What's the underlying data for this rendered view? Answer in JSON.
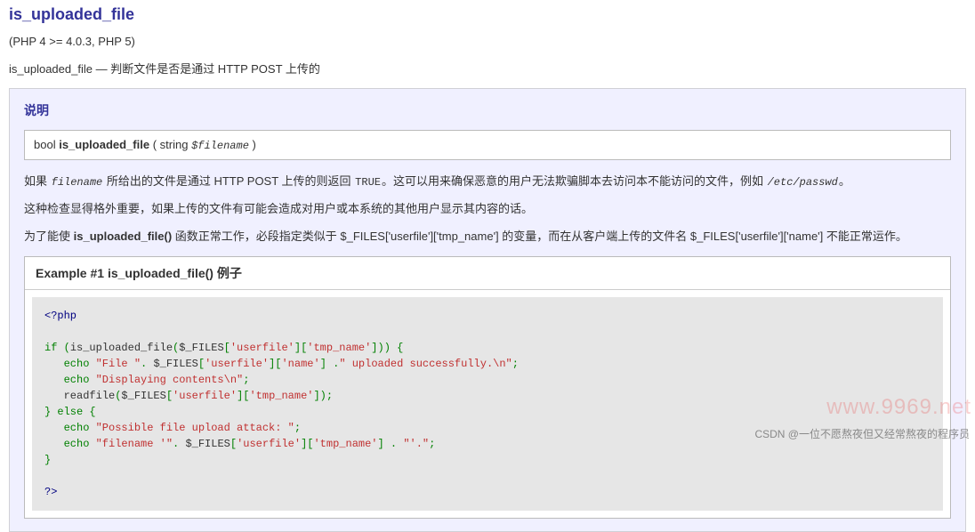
{
  "title": "is_uploaded_file",
  "verinfo": "(PHP 4 >= 4.0.3, PHP 5)",
  "refpurpose_a": "is_uploaded_file — 判断文件是否是通过 HTTP POST 上传的",
  "section_title": "说明",
  "synopsis": {
    "return_type": "bool",
    "name": "is_uploaded_file",
    "open": " ( ",
    "ptype": "string",
    "pvar": "$filename",
    "close": " )"
  },
  "p1_a": "如果 ",
  "p1_b": "filename",
  "p1_c": " 所给出的文件是通过 HTTP POST 上传的则返回 ",
  "p1_d": "TRUE",
  "p1_e": "。这可以用来确保恶意的用户无法欺骗脚本去访问本不能访问的文件，例如 ",
  "p1_f": "/etc/passwd",
  "p1_g": "。",
  "p2": "这种检查显得格外重要，如果上传的文件有可能会造成对用户或本系统的其他用户显示其内容的话。",
  "p3_a": "为了能使 ",
  "p3_b": "is_uploaded_file()",
  "p3_c": " 函数正常工作，必段指定类似于 $_FILES['userfile']['tmp_name'] 的变量，而在从客户端上传的文件名 $_FILES['userfile']['name'] 不能正常运作。",
  "example_title_a": "Example #1 ",
  "example_title_b": "is_uploaded_file()",
  "example_title_c": " 例子",
  "code": {
    "l01": "<?php",
    "l02a": "if (",
    "l02b": "is_uploaded_file",
    "l02c": "(",
    "l02d": "$_FILES",
    "l02e": "[",
    "l02f": "'userfile'",
    "l02g": "][",
    "l02h": "'tmp_name'",
    "l02i": "])) {",
    "l03a": "   echo ",
    "l03b": "\"File \"",
    "l03c": ". ",
    "l03d": "$_FILES",
    "l03e": "[",
    "l03f": "'userfile'",
    "l03g": "][",
    "l03h": "'name'",
    "l03i": "] .",
    "l03j": "\" uploaded successfully.\\n\"",
    "l03k": ";",
    "l04a": "   echo ",
    "l04b": "\"Displaying contents\\n\"",
    "l04c": ";",
    "l05a": "   ",
    "l05b": "readfile",
    "l05c": "(",
    "l05d": "$_FILES",
    "l05e": "[",
    "l05f": "'userfile'",
    "l05g": "][",
    "l05h": "'tmp_name'",
    "l05i": "]);",
    "l06": "} else {",
    "l07a": "   echo ",
    "l07b": "\"Possible file upload attack: \"",
    "l07c": ";",
    "l08a": "   echo ",
    "l08b": "\"filename '\"",
    "l08c": ". ",
    "l08d": "$_FILES",
    "l08e": "[",
    "l08f": "'userfile'",
    "l08g": "][",
    "l08h": "'tmp_name'",
    "l08i": "] . ",
    "l08j": "\"'.\"",
    "l08k": ";",
    "l09": "}",
    "l11": "?>"
  },
  "watermark1": "www.9969.net",
  "watermark2": "CSDN @一位不愿熬夜但又经常熬夜的程序员"
}
